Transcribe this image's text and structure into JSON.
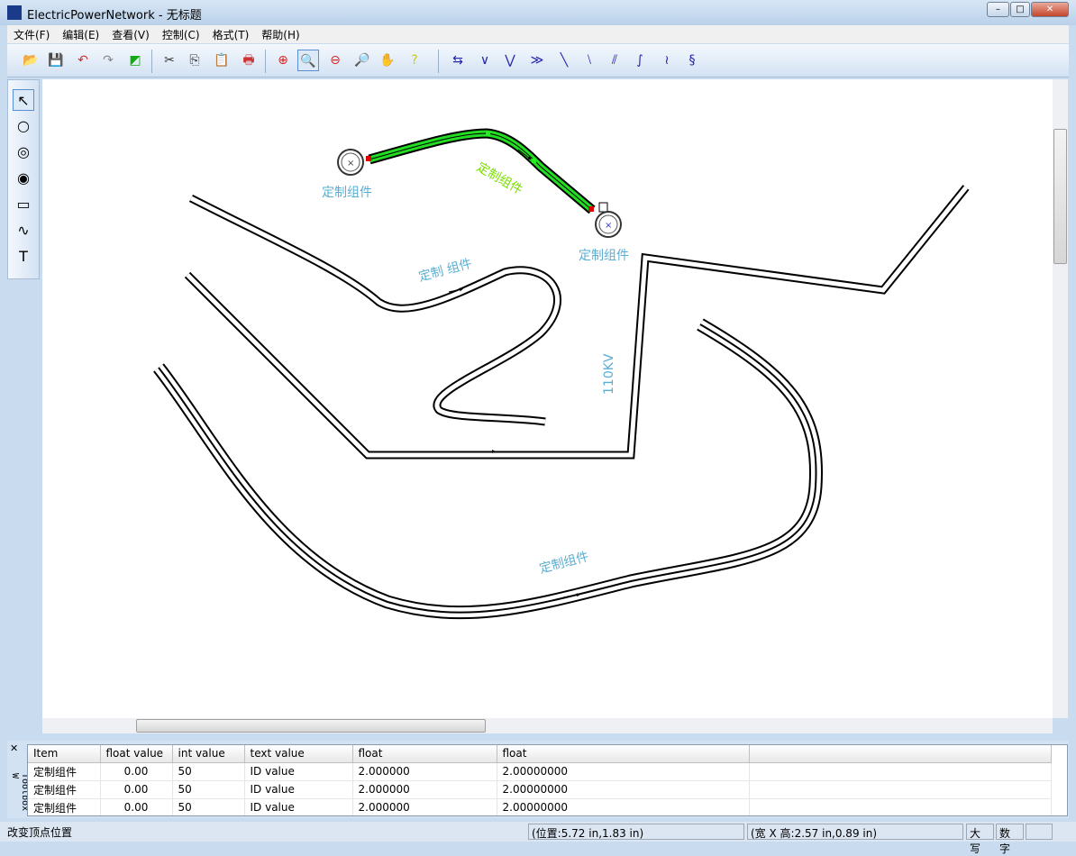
{
  "window": {
    "title": "ElectricPowerNetwork - 无标题",
    "min": "–",
    "max": "□",
    "close": "✕"
  },
  "menu": [
    "文件(F)",
    "编辑(E)",
    "查看(V)",
    "控制(C)",
    "格式(T)",
    "帮助(H)"
  ],
  "toolbar": [
    {
      "icon": "open-folder-icon",
      "g": "📂"
    },
    {
      "icon": "save-icon",
      "g": "💾"
    },
    {
      "icon": "undo-icon",
      "g": "↶"
    },
    {
      "icon": "redo-icon",
      "g": "↷"
    },
    {
      "icon": "fill-icon",
      "g": "◩"
    },
    {
      "icon": "cut-icon",
      "g": "✂"
    },
    {
      "icon": "copy-icon",
      "g": "⎘"
    },
    {
      "icon": "paste-icon",
      "g": "📋"
    },
    {
      "icon": "print-icon",
      "g": "🖶"
    },
    {
      "icon": "zoom-in-icon",
      "g": "⊕"
    },
    {
      "icon": "zoom-icon",
      "g": "🔍"
    },
    {
      "icon": "zoom-out-icon",
      "g": "⊖"
    },
    {
      "icon": "zoom-fit-icon",
      "g": "🔎"
    },
    {
      "icon": "pan-hand-icon",
      "g": "✋"
    },
    {
      "icon": "help-icon",
      "g": "?"
    },
    {
      "icon": "connect-icon",
      "g": "⇆"
    },
    {
      "icon": "polyline-icon",
      "g": "∨"
    },
    {
      "icon": "double-polyline-icon",
      "g": "⋁"
    },
    {
      "icon": "triple-polyline-icon",
      "g": "≫"
    },
    {
      "icon": "line-icon",
      "g": "╲"
    },
    {
      "icon": "double-line-icon",
      "g": "⧵"
    },
    {
      "icon": "triple-line-icon",
      "g": "⫽"
    },
    {
      "icon": "curve-icon",
      "g": "∫"
    },
    {
      "icon": "double-curve-icon",
      "g": "≀"
    },
    {
      "icon": "triple-curve-icon",
      "g": "§"
    }
  ],
  "toolbox": [
    {
      "icon": "pointer-icon",
      "g": "↖"
    },
    {
      "icon": "circle-icon",
      "g": "○"
    },
    {
      "icon": "double-circle-icon",
      "g": "◎"
    },
    {
      "icon": "triple-circle-icon",
      "g": "◉"
    },
    {
      "icon": "rectangle-icon",
      "g": "▭"
    },
    {
      "icon": "wave-icon",
      "g": "∿"
    },
    {
      "icon": "text-icon",
      "g": "T"
    }
  ],
  "canvas": {
    "labels": [
      "定制组件",
      "定制组件",
      "定制组件",
      "定制 组件",
      "定制组件",
      "110KV"
    ],
    "selected_color": "#22dd22",
    "label_color": "#5aaed2"
  },
  "panel": {
    "side_label": "Toolbox W",
    "close": "✕",
    "columns": [
      "Item",
      "float value",
      "int value",
      "text value",
      "float",
      "float"
    ],
    "rows": [
      [
        "定制组件",
        "0.00",
        "50",
        "ID value",
        "2.000000",
        "2.00000000"
      ],
      [
        "定制组件",
        "0.00",
        "50",
        "ID value",
        "2.000000",
        "2.00000000"
      ],
      [
        "定制组件",
        "0.00",
        "50",
        "ID value",
        "2.000000",
        "2.00000000"
      ]
    ]
  },
  "status": {
    "message": "改变顶点位置",
    "position": "(位置:5.72 in,1.83 in)",
    "size": "(宽 X 高:2.57 in,0.89 in)",
    "caps": "大写",
    "num": "数字"
  }
}
